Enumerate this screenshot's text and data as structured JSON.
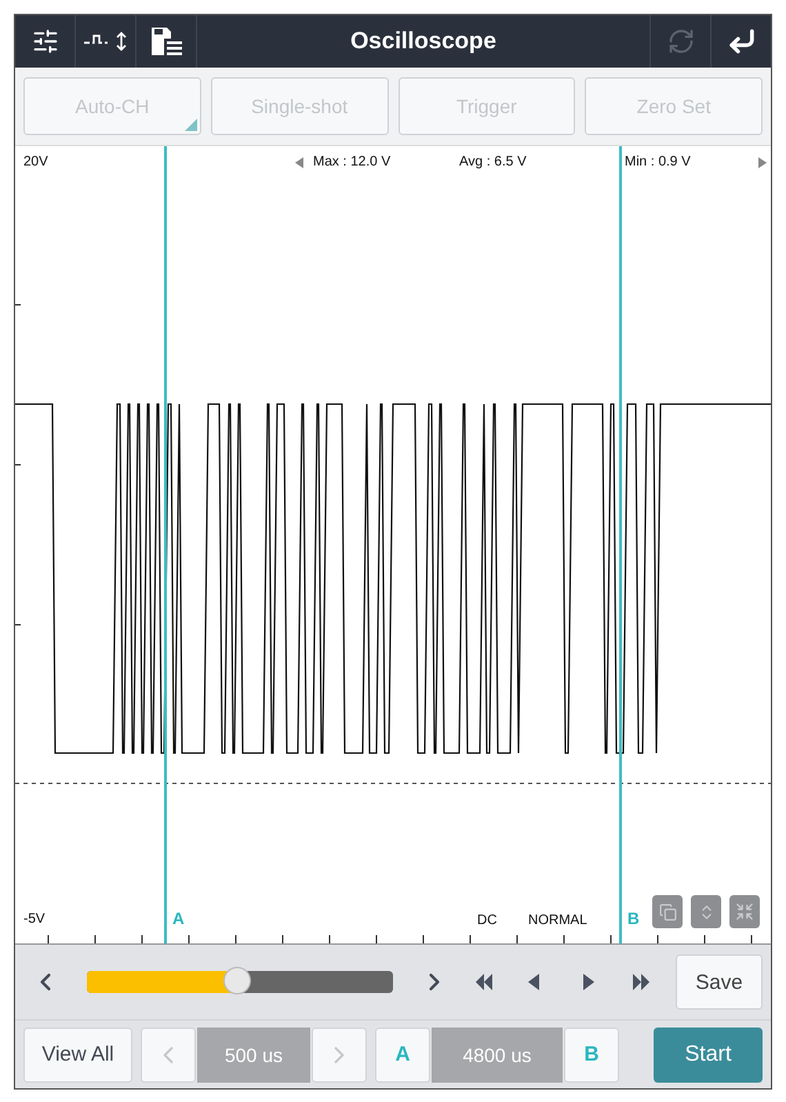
{
  "header": {
    "title": "Oscilloscope",
    "refresh_disabled": true
  },
  "mode_buttons": [
    {
      "label": "Auto-CH",
      "disabled": true,
      "dropdown": true
    },
    {
      "label": "Single-shot",
      "disabled": true,
      "dropdown": false
    },
    {
      "label": "Trigger",
      "disabled": true,
      "dropdown": false
    },
    {
      "label": "Zero Set",
      "disabled": true,
      "dropdown": false
    }
  ],
  "plot": {
    "top_label": "20V",
    "bottom_label": "-5V",
    "stats": [
      "Max : 12.0 V",
      "Avg : 6.5 V",
      "Min : 0.9 V"
    ],
    "cursor_a": "A",
    "cursor_b": "B",
    "coupling": "DC",
    "trigger_mode": "NORMAL"
  },
  "playback": {
    "level": 0.49,
    "save": "Save"
  },
  "bottom_bar": {
    "view_all": "View All",
    "timebase": "500 us",
    "cursor_a": "A",
    "cursor_delta": "4800 us",
    "cursor_b": "B",
    "start": "Start"
  }
}
